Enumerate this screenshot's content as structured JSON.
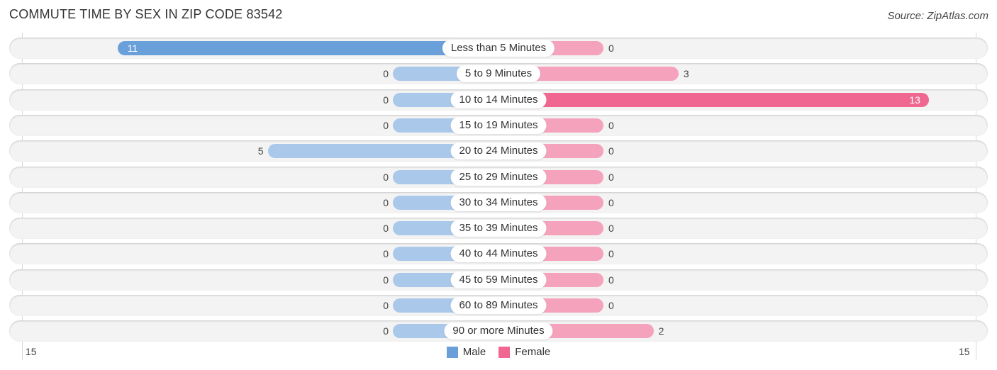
{
  "header": {
    "title": "COMMUTE TIME BY SEX IN ZIP CODE 83542",
    "source": "Source: ZipAtlas.com"
  },
  "chart_data": {
    "type": "bar",
    "orientation": "horizontal-diverging",
    "title": "COMMUTE TIME BY SEX IN ZIP CODE 83542",
    "categories": [
      "Less than 5 Minutes",
      "5 to 9 Minutes",
      "10 to 14 Minutes",
      "15 to 19 Minutes",
      "20 to 24 Minutes",
      "25 to 29 Minutes",
      "30 to 34 Minutes",
      "35 to 39 Minutes",
      "40 to 44 Minutes",
      "45 to 59 Minutes",
      "60 to 89 Minutes",
      "90 or more Minutes"
    ],
    "series": [
      {
        "name": "Male",
        "color": "#6aa0da",
        "values": [
          11,
          0,
          0,
          0,
          5,
          0,
          0,
          0,
          0,
          0,
          0,
          0
        ]
      },
      {
        "name": "Female",
        "color": "#f06892",
        "values": [
          0,
          3,
          13,
          0,
          0,
          0,
          0,
          0,
          0,
          0,
          0,
          2
        ]
      }
    ],
    "axis": {
      "left_tick": "15",
      "right_tick": "15",
      "range": [
        -15,
        15
      ]
    },
    "legend": {
      "position": "bottom-center",
      "items": [
        "Male",
        "Female"
      ]
    },
    "grid": false
  }
}
